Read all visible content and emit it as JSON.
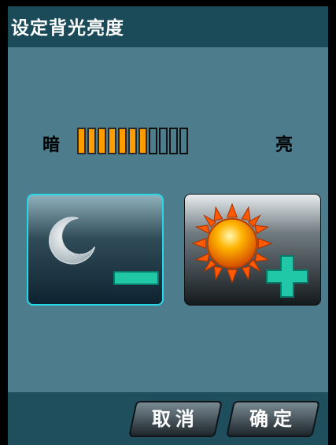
{
  "title": "设定背光亮度",
  "brightness": {
    "dark_label": "暗",
    "bright_label": "亮",
    "level": 7,
    "max_level": 11,
    "active_color": "#ff9d00"
  },
  "buttons": {
    "decrease_icon": "moon-minus-icon",
    "increase_icon": "sun-plus-icon",
    "cancel_label": "取消",
    "ok_label": "确定"
  },
  "colors": {
    "titlebar": "#1b4a58",
    "background": "#4d7c8c",
    "accent": "#26d7e6",
    "plus_minus": "#21c8a8"
  }
}
